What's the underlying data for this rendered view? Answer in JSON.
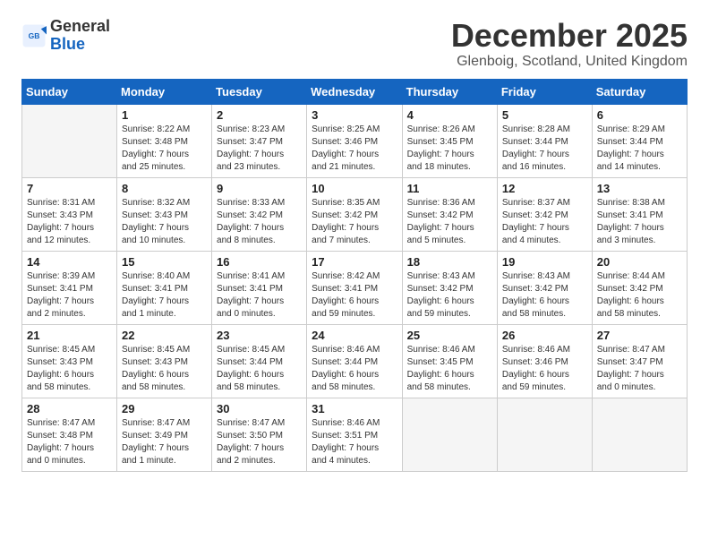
{
  "header": {
    "logo_line1": "General",
    "logo_line2": "Blue",
    "title": "December 2025",
    "subtitle": "Glenboig, Scotland, United Kingdom"
  },
  "calendar": {
    "headers": [
      "Sunday",
      "Monday",
      "Tuesday",
      "Wednesday",
      "Thursday",
      "Friday",
      "Saturday"
    ],
    "weeks": [
      [
        {
          "day": "",
          "info": ""
        },
        {
          "day": "1",
          "info": "Sunrise: 8:22 AM\nSunset: 3:48 PM\nDaylight: 7 hours\nand 25 minutes."
        },
        {
          "day": "2",
          "info": "Sunrise: 8:23 AM\nSunset: 3:47 PM\nDaylight: 7 hours\nand 23 minutes."
        },
        {
          "day": "3",
          "info": "Sunrise: 8:25 AM\nSunset: 3:46 PM\nDaylight: 7 hours\nand 21 minutes."
        },
        {
          "day": "4",
          "info": "Sunrise: 8:26 AM\nSunset: 3:45 PM\nDaylight: 7 hours\nand 18 minutes."
        },
        {
          "day": "5",
          "info": "Sunrise: 8:28 AM\nSunset: 3:44 PM\nDaylight: 7 hours\nand 16 minutes."
        },
        {
          "day": "6",
          "info": "Sunrise: 8:29 AM\nSunset: 3:44 PM\nDaylight: 7 hours\nand 14 minutes."
        }
      ],
      [
        {
          "day": "7",
          "info": "Sunrise: 8:31 AM\nSunset: 3:43 PM\nDaylight: 7 hours\nand 12 minutes."
        },
        {
          "day": "8",
          "info": "Sunrise: 8:32 AM\nSunset: 3:43 PM\nDaylight: 7 hours\nand 10 minutes."
        },
        {
          "day": "9",
          "info": "Sunrise: 8:33 AM\nSunset: 3:42 PM\nDaylight: 7 hours\nand 8 minutes."
        },
        {
          "day": "10",
          "info": "Sunrise: 8:35 AM\nSunset: 3:42 PM\nDaylight: 7 hours\nand 7 minutes."
        },
        {
          "day": "11",
          "info": "Sunrise: 8:36 AM\nSunset: 3:42 PM\nDaylight: 7 hours\nand 5 minutes."
        },
        {
          "day": "12",
          "info": "Sunrise: 8:37 AM\nSunset: 3:42 PM\nDaylight: 7 hours\nand 4 minutes."
        },
        {
          "day": "13",
          "info": "Sunrise: 8:38 AM\nSunset: 3:41 PM\nDaylight: 7 hours\nand 3 minutes."
        }
      ],
      [
        {
          "day": "14",
          "info": "Sunrise: 8:39 AM\nSunset: 3:41 PM\nDaylight: 7 hours\nand 2 minutes."
        },
        {
          "day": "15",
          "info": "Sunrise: 8:40 AM\nSunset: 3:41 PM\nDaylight: 7 hours\nand 1 minute."
        },
        {
          "day": "16",
          "info": "Sunrise: 8:41 AM\nSunset: 3:41 PM\nDaylight: 7 hours\nand 0 minutes."
        },
        {
          "day": "17",
          "info": "Sunrise: 8:42 AM\nSunset: 3:41 PM\nDaylight: 6 hours\nand 59 minutes."
        },
        {
          "day": "18",
          "info": "Sunrise: 8:43 AM\nSunset: 3:42 PM\nDaylight: 6 hours\nand 59 minutes."
        },
        {
          "day": "19",
          "info": "Sunrise: 8:43 AM\nSunset: 3:42 PM\nDaylight: 6 hours\nand 58 minutes."
        },
        {
          "day": "20",
          "info": "Sunrise: 8:44 AM\nSunset: 3:42 PM\nDaylight: 6 hours\nand 58 minutes."
        }
      ],
      [
        {
          "day": "21",
          "info": "Sunrise: 8:45 AM\nSunset: 3:43 PM\nDaylight: 6 hours\nand 58 minutes."
        },
        {
          "day": "22",
          "info": "Sunrise: 8:45 AM\nSunset: 3:43 PM\nDaylight: 6 hours\nand 58 minutes."
        },
        {
          "day": "23",
          "info": "Sunrise: 8:45 AM\nSunset: 3:44 PM\nDaylight: 6 hours\nand 58 minutes."
        },
        {
          "day": "24",
          "info": "Sunrise: 8:46 AM\nSunset: 3:44 PM\nDaylight: 6 hours\nand 58 minutes."
        },
        {
          "day": "25",
          "info": "Sunrise: 8:46 AM\nSunset: 3:45 PM\nDaylight: 6 hours\nand 58 minutes."
        },
        {
          "day": "26",
          "info": "Sunrise: 8:46 AM\nSunset: 3:46 PM\nDaylight: 6 hours\nand 59 minutes."
        },
        {
          "day": "27",
          "info": "Sunrise: 8:47 AM\nSunset: 3:47 PM\nDaylight: 7 hours\nand 0 minutes."
        }
      ],
      [
        {
          "day": "28",
          "info": "Sunrise: 8:47 AM\nSunset: 3:48 PM\nDaylight: 7 hours\nand 0 minutes."
        },
        {
          "day": "29",
          "info": "Sunrise: 8:47 AM\nSunset: 3:49 PM\nDaylight: 7 hours\nand 1 minute."
        },
        {
          "day": "30",
          "info": "Sunrise: 8:47 AM\nSunset: 3:50 PM\nDaylight: 7 hours\nand 2 minutes."
        },
        {
          "day": "31",
          "info": "Sunrise: 8:46 AM\nSunset: 3:51 PM\nDaylight: 7 hours\nand 4 minutes."
        },
        {
          "day": "",
          "info": ""
        },
        {
          "day": "",
          "info": ""
        },
        {
          "day": "",
          "info": ""
        }
      ]
    ]
  }
}
